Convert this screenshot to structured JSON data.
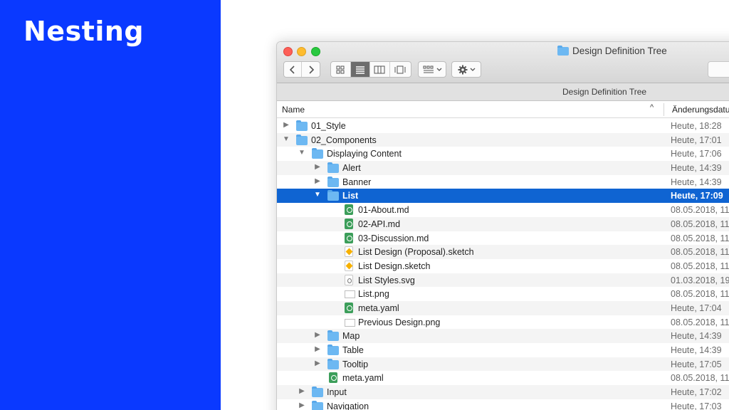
{
  "slide": {
    "title": "Nesting"
  },
  "window": {
    "title": "Design Definition Tree",
    "path_title": "Design Definition Tree",
    "columns": {
      "name": "Name",
      "sort_indicator": "^",
      "date": "Änderungsdatu"
    }
  },
  "toolbar": {
    "back_icon": "chevron-left-icon",
    "forward_icon": "chevron-right-icon",
    "views": [
      "icon-view-icon",
      "list-view-icon",
      "column-view-icon",
      "gallery-view-icon"
    ],
    "active_view": "list-view-icon",
    "arrange_icon": "arrange-icon",
    "action_icon": "gear-icon"
  },
  "colors": {
    "accent": "#0a39ff",
    "selection": "#0f64d2",
    "folder": "#6db8f2"
  },
  "rows": [
    {
      "name": "01_Style",
      "date": "Heute, 18:28",
      "type": "folder",
      "level": 0,
      "disclosure": "▶"
    },
    {
      "name": "02_Components",
      "date": "Heute, 17:01",
      "type": "folder",
      "level": 0,
      "disclosure": "▼"
    },
    {
      "name": "Displaying Content",
      "date": "Heute, 17:06",
      "type": "folder",
      "level": 1,
      "disclosure": "▼"
    },
    {
      "name": "Alert",
      "date": "Heute, 14:39",
      "type": "folder",
      "level": 2,
      "disclosure": "▶"
    },
    {
      "name": "Banner",
      "date": "Heute, 14:39",
      "type": "folder",
      "level": 2,
      "disclosure": "▶"
    },
    {
      "name": "List",
      "date": "Heute, 17:09",
      "type": "folder",
      "level": 2,
      "disclosure": "▼",
      "selected": true
    },
    {
      "name": "01-About.md",
      "date": "08.05.2018, 11",
      "type": "md",
      "level": 3,
      "disclosure": ""
    },
    {
      "name": "02-API.md",
      "date": "08.05.2018, 11",
      "type": "md",
      "level": 3,
      "disclosure": ""
    },
    {
      "name": "03-Discussion.md",
      "date": "08.05.2018, 11",
      "type": "md",
      "level": 3,
      "disclosure": ""
    },
    {
      "name": "List Design (Proposal).sketch",
      "date": "08.05.2018, 11",
      "type": "sketch",
      "level": 3,
      "disclosure": ""
    },
    {
      "name": "List Design.sketch",
      "date": "08.05.2018, 11",
      "type": "sketch",
      "level": 3,
      "disclosure": ""
    },
    {
      "name": "List Styles.svg",
      "date": "01.03.2018, 19",
      "type": "svg",
      "level": 3,
      "disclosure": ""
    },
    {
      "name": "List.png",
      "date": "08.05.2018, 11",
      "type": "png",
      "level": 3,
      "disclosure": ""
    },
    {
      "name": "meta.yaml",
      "date": "Heute, 17:04",
      "type": "md",
      "level": 3,
      "disclosure": ""
    },
    {
      "name": "Previous Design.png",
      "date": "08.05.2018, 11",
      "type": "png",
      "level": 3,
      "disclosure": ""
    },
    {
      "name": "Map",
      "date": "Heute, 14:39",
      "type": "folder",
      "level": 2,
      "disclosure": "▶"
    },
    {
      "name": "Table",
      "date": "Heute, 14:39",
      "type": "folder",
      "level": 2,
      "disclosure": "▶"
    },
    {
      "name": "Tooltip",
      "date": "Heute, 17:05",
      "type": "folder",
      "level": 2,
      "disclosure": "▶"
    },
    {
      "name": "meta.yaml",
      "date": "08.05.2018, 11",
      "type": "md",
      "level": 2,
      "disclosure": ""
    },
    {
      "name": "Input",
      "date": "Heute, 17:02",
      "type": "folder",
      "level": 1,
      "disclosure": "▶"
    },
    {
      "name": "Navigation",
      "date": "Heute, 17:03",
      "type": "folder",
      "level": 1,
      "disclosure": "▶"
    }
  ]
}
